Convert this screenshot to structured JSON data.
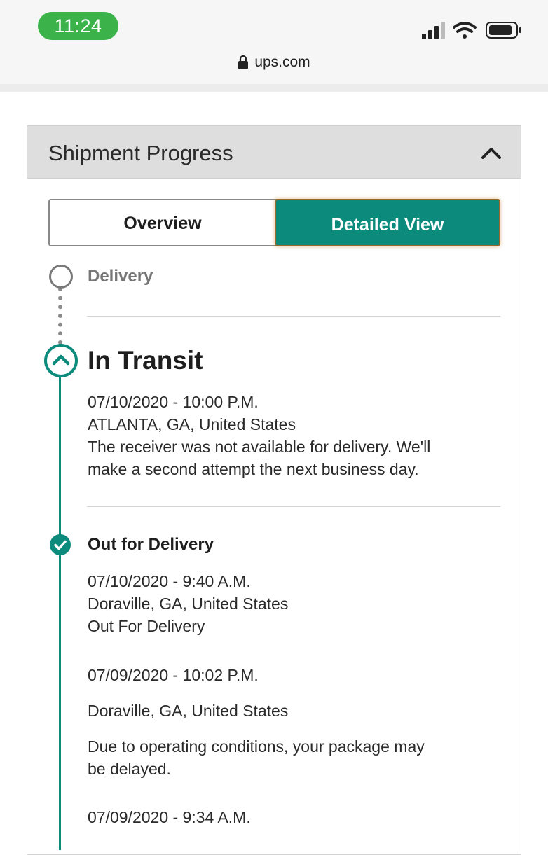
{
  "status_bar": {
    "time": "11:24",
    "url": "ups.com",
    "icons": [
      "signal-icon",
      "wifi-icon",
      "battery-icon",
      "lock-icon"
    ]
  },
  "shipment": {
    "title": "Shipment Progress",
    "tabs": [
      {
        "label": "Overview",
        "selected": false
      },
      {
        "label": "Detailed View",
        "selected": true
      }
    ],
    "milestones": {
      "delivery": "Delivery",
      "in_transit": "In Transit",
      "out_for_delivery": "Out for Delivery"
    },
    "events": {
      "transit_1": {
        "datetime": "07/10/2020 - 10:00 P.M.",
        "location": "ATLANTA, GA, United States",
        "desc_line1": "The receiver was not available for delivery. We'll",
        "desc_line2": "make a second attempt the next business day."
      },
      "ofd_1": {
        "datetime": "07/10/2020 - 9:40 A.M.",
        "location": "Doraville, GA, United States",
        "desc": "Out For Delivery"
      },
      "ofd_2": {
        "datetime": "07/09/2020 - 10:02 P.M.",
        "location": "Doraville, GA, United States",
        "desc_line1": "Due to operating conditions, your package may",
        "desc_line2": "be delayed."
      },
      "ofd_3": {
        "datetime": "07/09/2020 - 9:34 A.M."
      }
    }
  },
  "colors": {
    "accent": "#0c8a7c",
    "time_pill": "#3bb34a",
    "header_bg": "#dedede"
  }
}
